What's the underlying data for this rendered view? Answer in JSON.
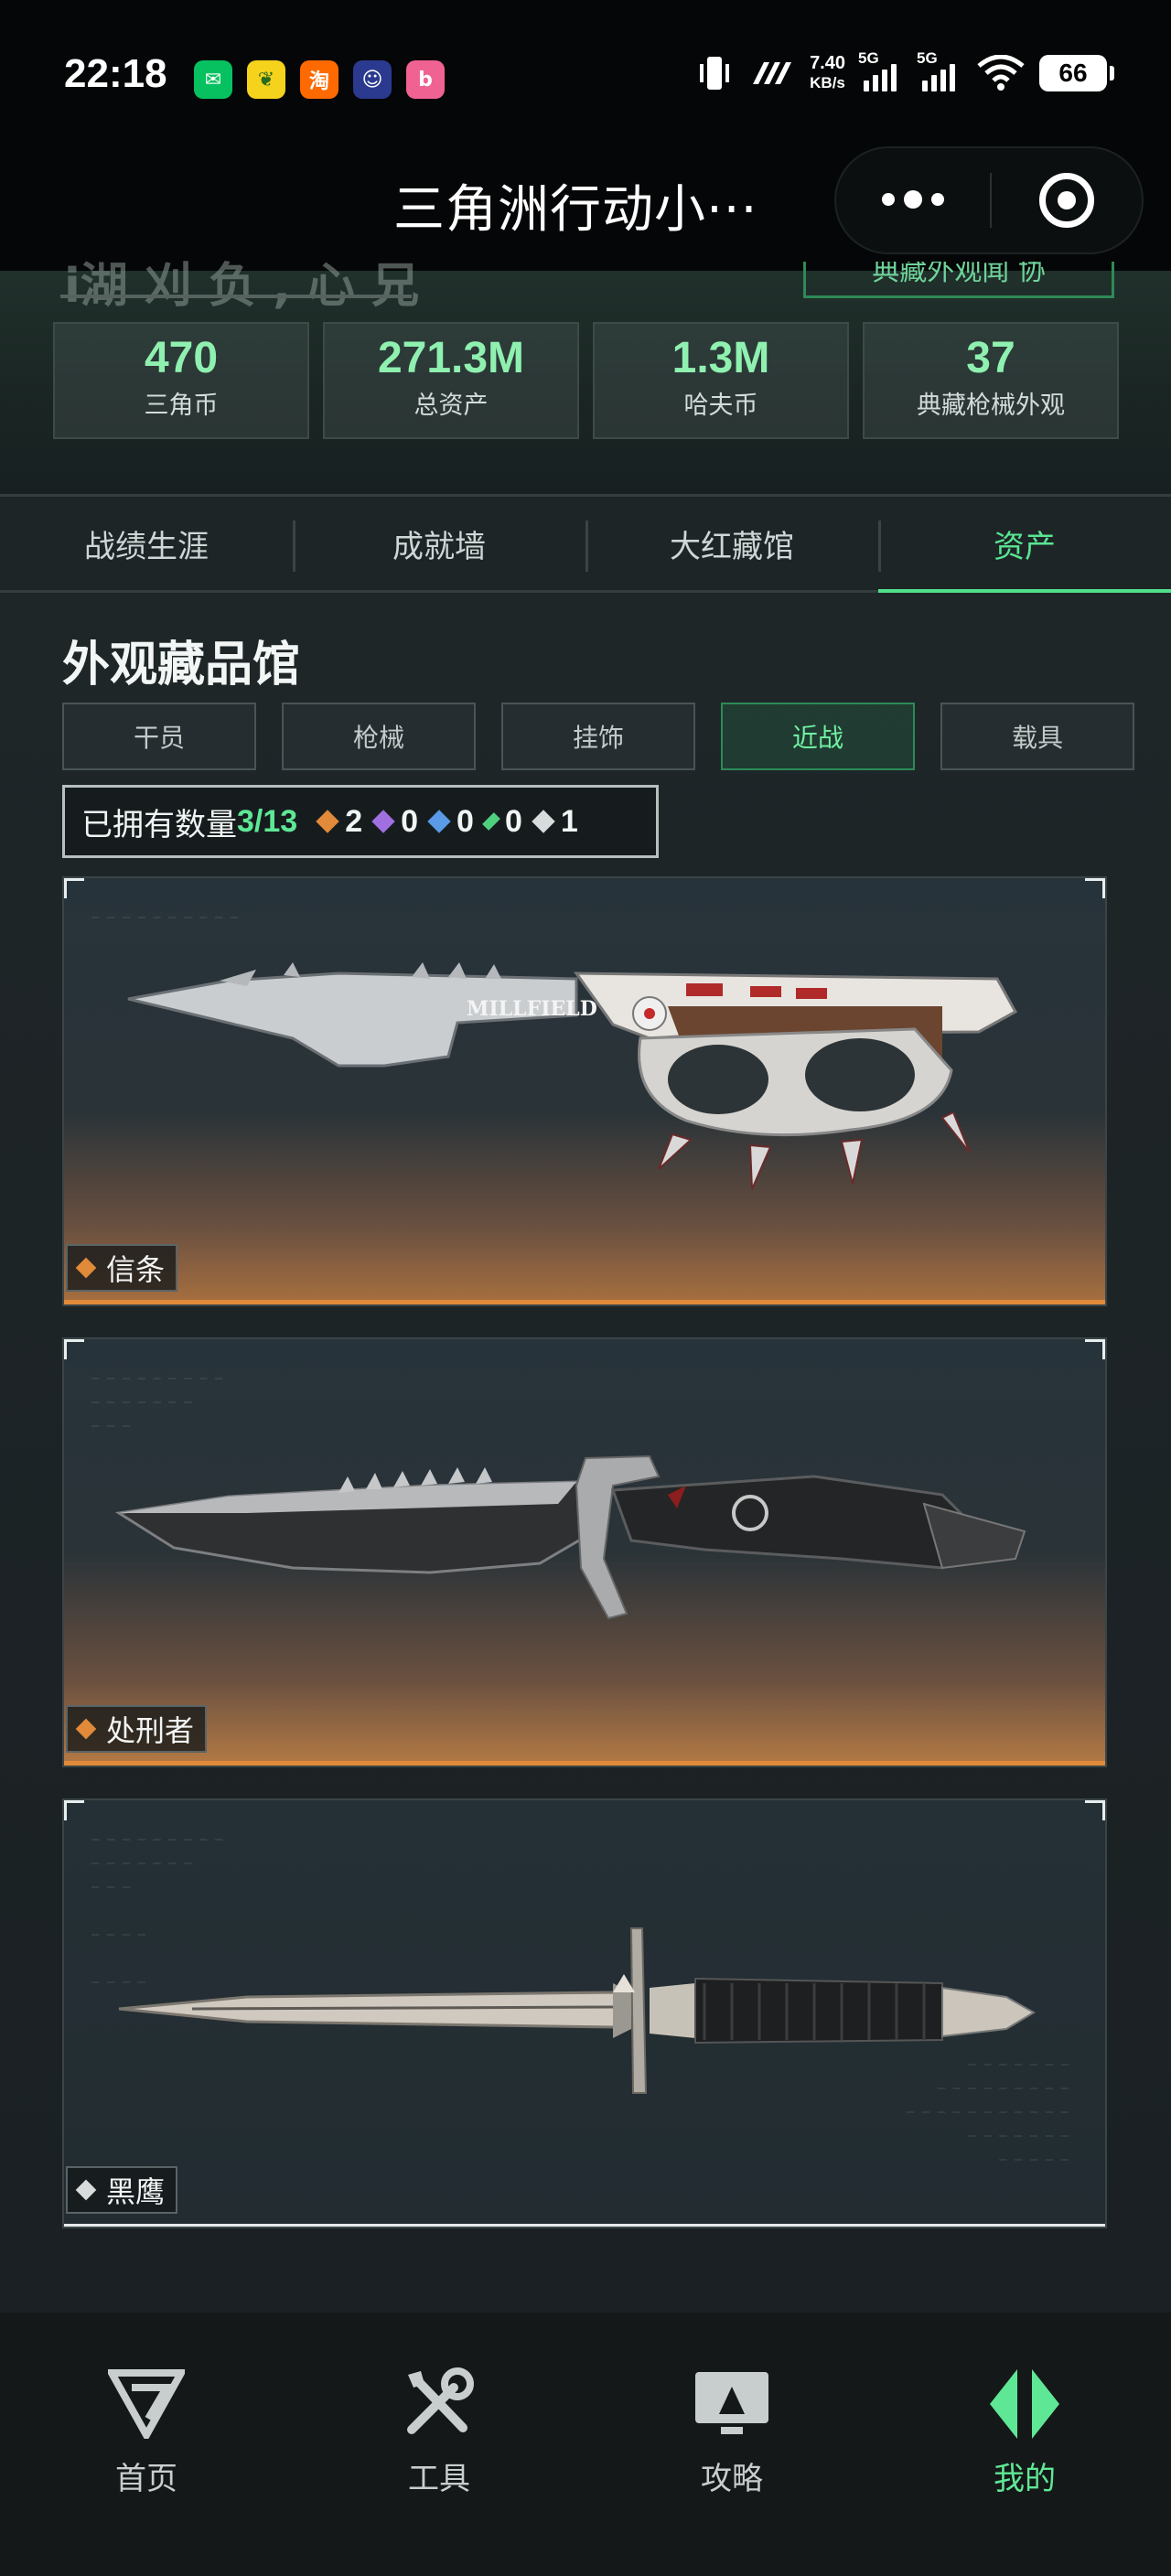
{
  "status_bar": {
    "time": "22:18",
    "apps": [
      {
        "icon": "wechat-icon",
        "glyph": "✉",
        "color": "#07c160"
      },
      {
        "icon": "cherry-app-icon",
        "glyph": "❦",
        "color": "#f5d21c"
      },
      {
        "icon": "taobao-icon",
        "glyph": "淘",
        "color": "#ff6a00"
      },
      {
        "icon": "robot-app-icon",
        "glyph": "☺",
        "color": "#2b3a8f"
      },
      {
        "icon": "bilibili-icon",
        "glyph": "b",
        "color": "#f06292"
      }
    ],
    "net_speed_value": "7.40",
    "net_speed_unit": "KB/s",
    "sim1": "5G",
    "sim2": "5G",
    "battery": "66"
  },
  "header": {
    "title": "三角洲行动小···"
  },
  "hero": {
    "ghost_title": "i湖 刈 负 , 心 兄",
    "ghost_button": "典藏外观闻 协",
    "stats": [
      {
        "value": "470",
        "label": "三角币"
      },
      {
        "value": "271.3M",
        "label": "总资产"
      },
      {
        "value": "1.3M",
        "label": "哈夫币"
      },
      {
        "value": "37",
        "label": "典藏枪械外观"
      }
    ]
  },
  "tabs": [
    {
      "label": "战绩生涯",
      "active": false
    },
    {
      "label": "成就墙",
      "active": false
    },
    {
      "label": "大红藏馆",
      "active": false
    },
    {
      "label": "资产",
      "active": true
    }
  ],
  "gallery": {
    "title": "外观藏品馆",
    "filters": [
      {
        "label": "干员",
        "active": false
      },
      {
        "label": "枪械",
        "active": false
      },
      {
        "label": "挂饰",
        "active": false
      },
      {
        "label": "近战",
        "active": true
      },
      {
        "label": "载具",
        "active": false
      }
    ],
    "owned_label": "已拥有数量",
    "owned_count": "3/13",
    "rarity_counts": [
      {
        "icon": "orange-rarity-icon",
        "color": "#e08a3a",
        "count": "2"
      },
      {
        "icon": "purple-rarity-icon",
        "color": "#a070e0",
        "count": "0"
      },
      {
        "icon": "blue-rarity-icon",
        "color": "#5a9ae6",
        "count": "0"
      },
      {
        "icon": "green-rarity-icon",
        "color": "#4fd07e",
        "count": "0"
      },
      {
        "icon": "white-rarity-icon",
        "color": "#d8dcdc",
        "count": "1"
      }
    ],
    "items": [
      {
        "name": "信条",
        "rarity_color": "#e08a3a",
        "blade_text": "MILLFIELD"
      },
      {
        "name": "处刑者",
        "rarity_color": "#e08a3a",
        "blade_text": ""
      },
      {
        "name": "黑鹰",
        "rarity_color": "#d8dcdc",
        "blade_text": ""
      }
    ]
  },
  "bottom_nav": [
    {
      "label": "首页",
      "icon": "delta-logo-icon",
      "active": false
    },
    {
      "label": "工具",
      "icon": "tools-icon",
      "active": false
    },
    {
      "label": "攻略",
      "icon": "guide-monitor-icon",
      "active": false
    },
    {
      "label": "我的",
      "icon": "profile-diamond-icon",
      "active": true
    }
  ],
  "colors": {
    "accent": "#5ee896",
    "orange_rarity": "#e08a3a",
    "background": "#1b2123"
  }
}
